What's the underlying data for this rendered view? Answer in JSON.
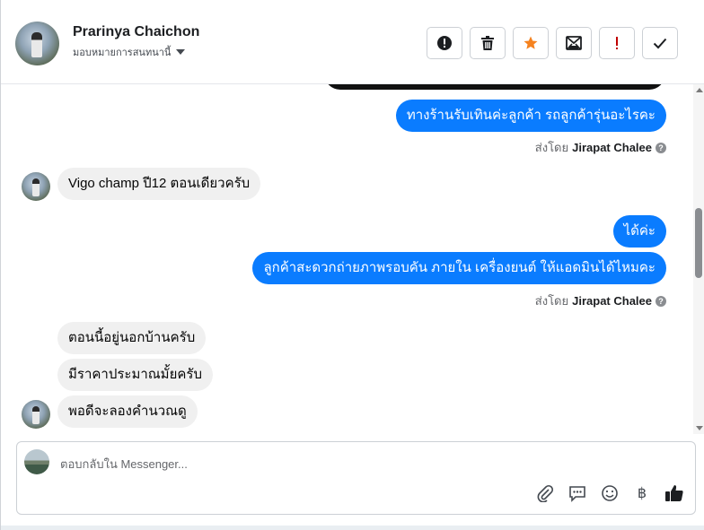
{
  "header": {
    "contact_name": "Prarinya Chaichon",
    "assign_label": "มอบหมายการสนทนานี้",
    "toolbar_icons": [
      "alert-icon",
      "trash-icon",
      "star-icon",
      "mark-unread-icon",
      "important-icon",
      "check-icon"
    ],
    "star_color": "#f5821f",
    "important_color": "#c00000"
  },
  "messages": [
    {
      "direction": "out",
      "text": "ทางร้านรับเทินค่ะลูกค้า รถลูกค้ารุ่นอะไรคะ"
    },
    {
      "type": "sentby",
      "prefix": "ส่งโดย",
      "agent": "Jirapat Chalee"
    },
    {
      "direction": "in",
      "text": "Vigo champ ปี12 ตอนเดียวครับ"
    },
    {
      "direction": "out",
      "text": "ได้ค่ะ"
    },
    {
      "direction": "out",
      "text": "ลูกค้าสะดวกถ่ายภาพรอบคัน ภายใน เครื่องยนต์ ให้แอดมินได้ไหมคะ"
    },
    {
      "type": "sentby",
      "prefix": "ส่งโดย",
      "agent": "Jirapat Chalee"
    },
    {
      "direction": "in",
      "text": "ตอนนี้อยู่นอกบ้านครับ"
    },
    {
      "direction": "in",
      "text": "มีราคาประมาณมั้ยครับ"
    },
    {
      "direction": "in",
      "text": "พอดีจะลองคำนวณดู"
    }
  ],
  "composer": {
    "placeholder": "ตอบกลับใน Messenger...",
    "icons": [
      "attach-icon",
      "saved-reply-icon",
      "emoji-icon",
      "baht-payment-icon",
      "like-icon"
    ]
  },
  "colors": {
    "outgoing_bubble": "#0a7cff",
    "incoming_bubble": "#f0f0f0"
  }
}
